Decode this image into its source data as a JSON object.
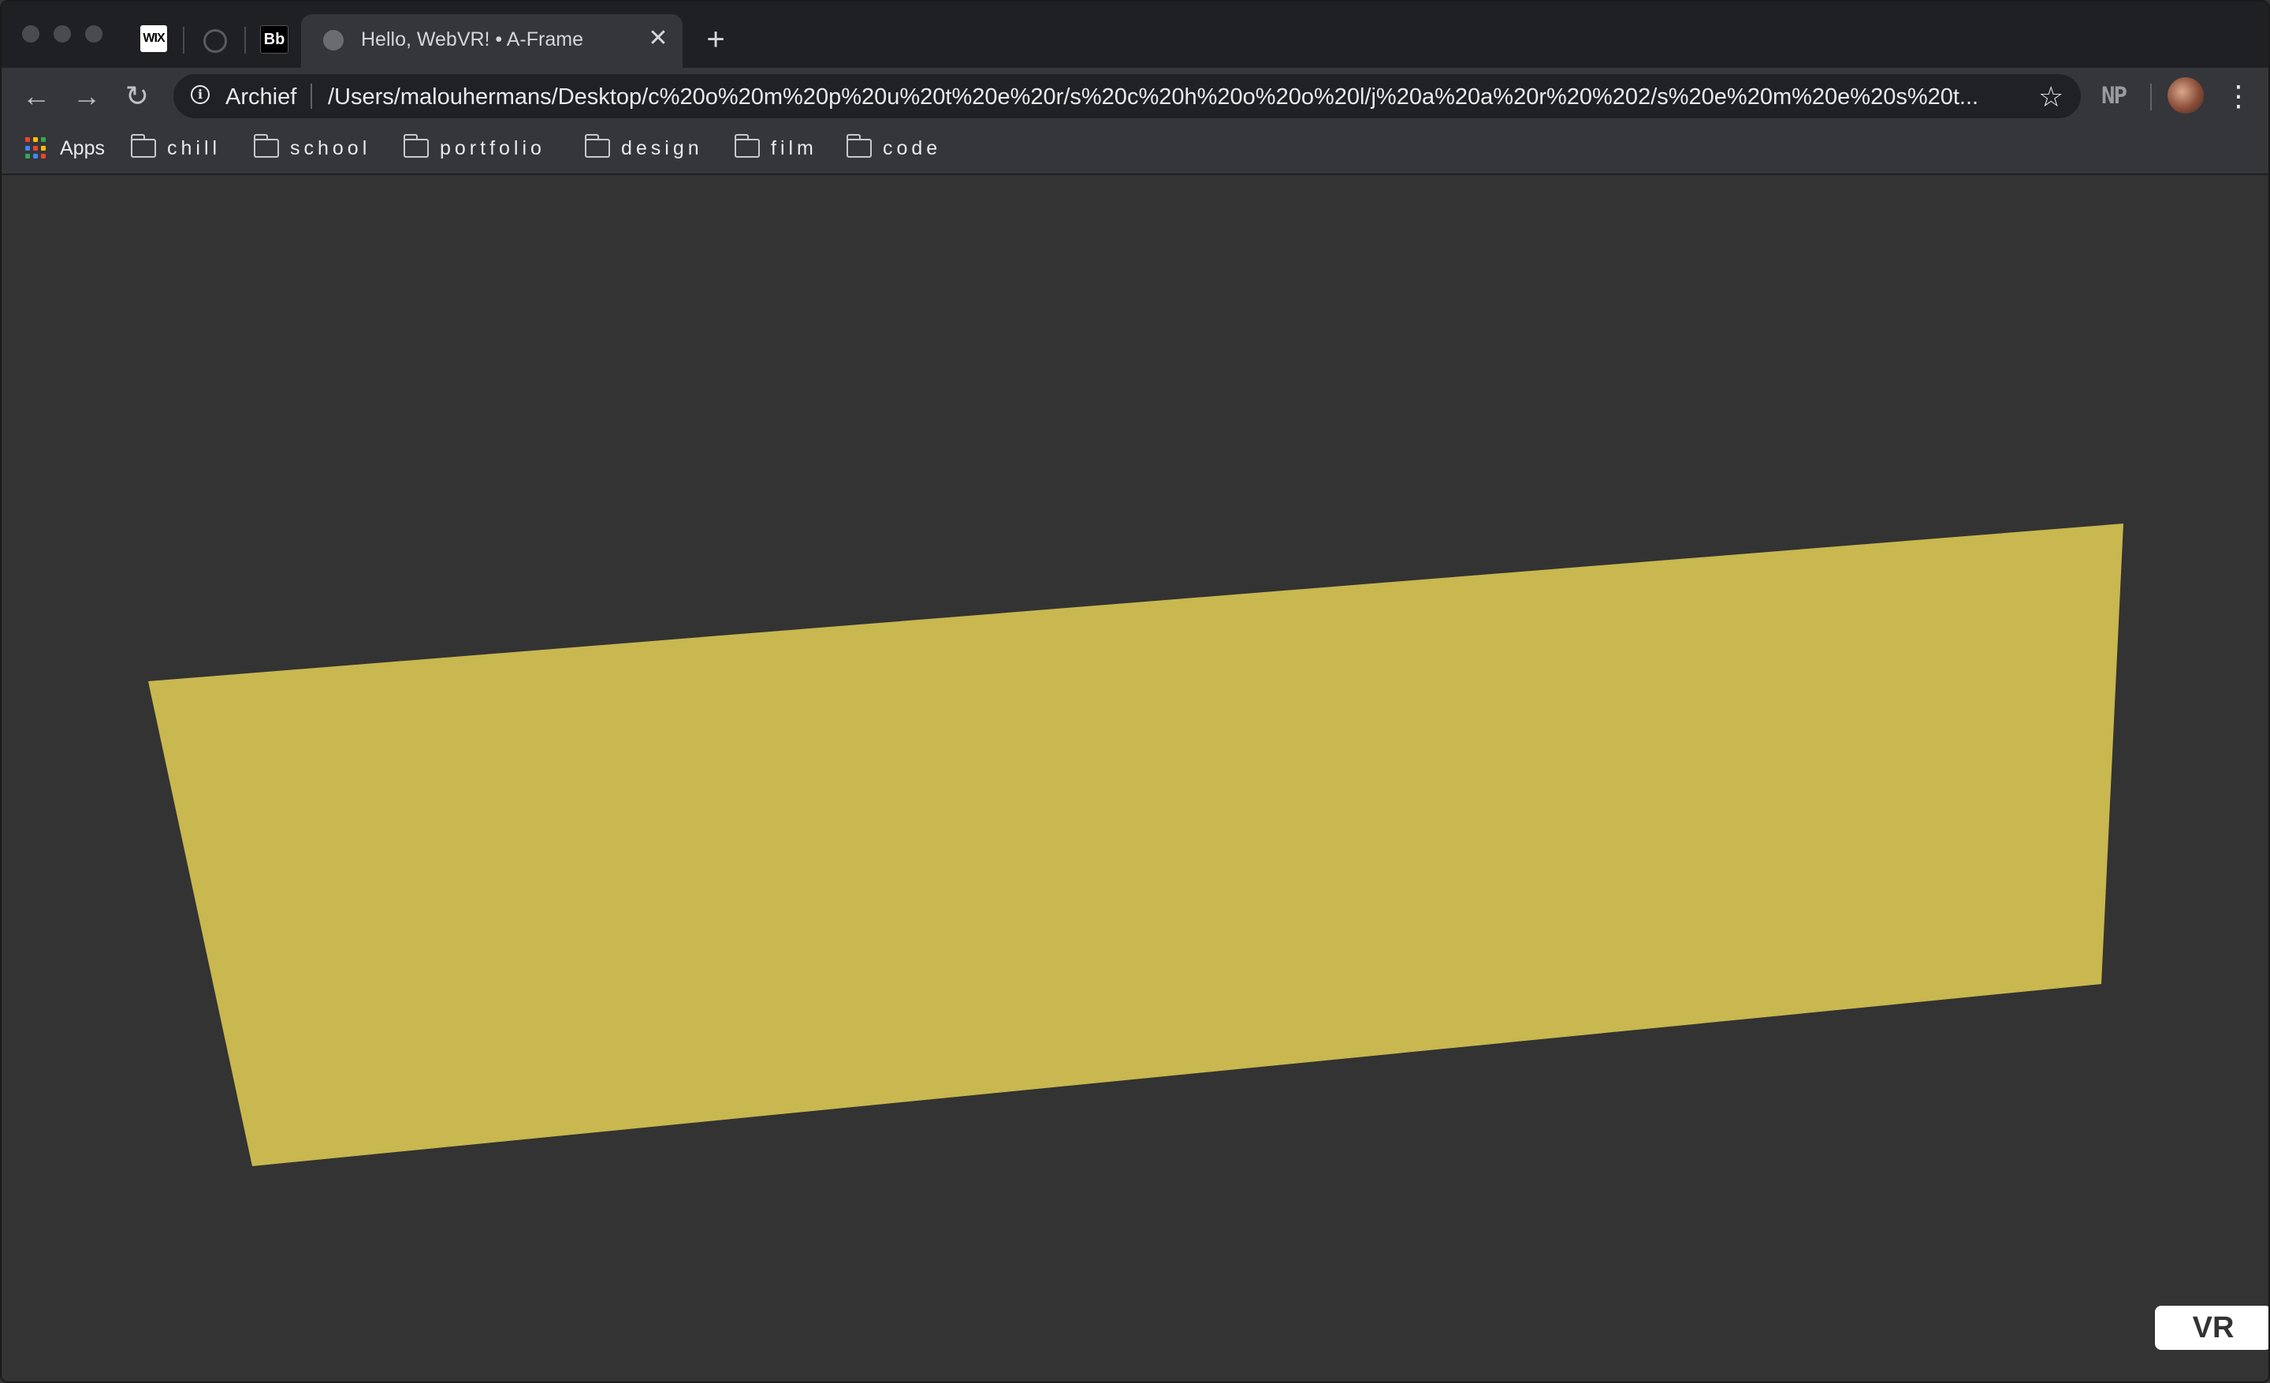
{
  "browser": {
    "tabs": [
      {
        "icon": "wix-favicon",
        "label": "WIX",
        "pinned": true
      },
      {
        "icon": "globe-icon",
        "pinned": true
      },
      {
        "icon": "behance-favicon",
        "label": "Bb",
        "pinned": true
      },
      {
        "icon": "globe-icon",
        "title": "Hello, WebVR! • A-Frame",
        "active": true
      }
    ],
    "close_glyph": "✕",
    "new_tab_glyph": "+",
    "nav": {
      "back": "←",
      "forward": "→",
      "reload": "↻"
    },
    "omnibox": {
      "info_glyph": "i",
      "site_label": "Archief",
      "url": "/Users/malouhermans/Desktop/c%20o%20m%20p%20u%20t%20e%20r/s%20c%20h%20o%20o%20l/j%20a%20a%20r%20%202/s%20e%20m%20e%20s%20t..."
    },
    "star_glyph": "☆",
    "extension_label": "NP",
    "menu_glyph": "⋮",
    "bookmarks": {
      "apps_label": "Apps",
      "apps_colors": [
        "#ea4335",
        "#fbbc05",
        "#34a853",
        "#4285f4",
        "#ea4335",
        "#fbbc05",
        "#34a853",
        "#4285f4",
        "#ea4335"
      ],
      "folders": [
        "chill",
        "school",
        "portfolio",
        "design",
        "film",
        "code"
      ]
    }
  },
  "scene": {
    "background_color": "#333333",
    "plane_color": "#c9b74f",
    "vr_button_label": "VR"
  }
}
